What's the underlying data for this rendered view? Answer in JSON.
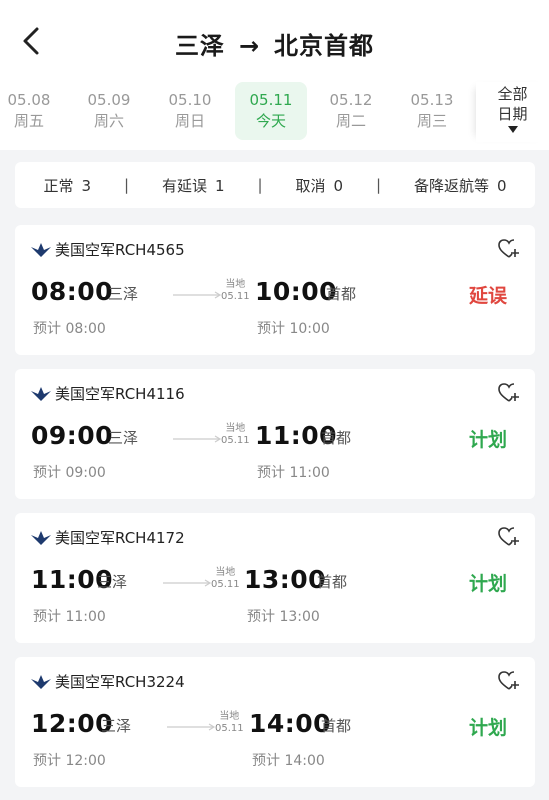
{
  "header": {
    "origin": "三泽",
    "arrow": "→",
    "destination": "北京首都"
  },
  "dates": [
    {
      "date": "05.08",
      "weekday": "周五"
    },
    {
      "date": "05.09",
      "weekday": "周六"
    },
    {
      "date": "05.10",
      "weekday": "周日"
    },
    {
      "date": "05.11",
      "weekday": "今天"
    },
    {
      "date": "05.12",
      "weekday": "周二"
    },
    {
      "date": "05.13",
      "weekday": "周三"
    }
  ],
  "all_dates": {
    "line1": "全部",
    "line2": "日期"
  },
  "summary": [
    {
      "label": "正常",
      "count": "3"
    },
    {
      "label": "有延误",
      "count": "1"
    },
    {
      "label": "取消",
      "count": "0"
    },
    {
      "label": "备降返航等",
      "count": "0"
    }
  ],
  "separator": "|",
  "flights": [
    {
      "airline": "美国空军",
      "number": "RCH4565",
      "dep_time": "08:00",
      "dep_city": "三泽",
      "local_label": "当地",
      "local_date": "05.11",
      "arr_time": "10:00",
      "arr_city": "首都",
      "dep_plan": "预计 08:00",
      "arr_plan": "预计 10:00",
      "status": "延误",
      "status_color": "#e0473f"
    },
    {
      "airline": "美国空军",
      "number": "RCH4116",
      "dep_time": "09:00",
      "dep_city": "三泽",
      "local_label": "当地",
      "local_date": "05.11",
      "arr_time": "11:00",
      "arr_city": "首都",
      "dep_plan": "预计 09:00",
      "arr_plan": "预计 11:00",
      "status": "计划",
      "status_color": "#2fa84f"
    },
    {
      "airline": "美国空军",
      "number": "RCH4172",
      "dep_time": "11:00",
      "dep_city": "三泽",
      "local_label": "当地",
      "local_date": "05.11",
      "arr_time": "13:00",
      "arr_city": "首都",
      "dep_plan": "预计 11:00",
      "arr_plan": "预计 13:00",
      "status": "计划",
      "status_color": "#2fa84f"
    },
    {
      "airline": "美国空军",
      "number": "RCH3224",
      "dep_time": "12:00",
      "dep_city": "三泽",
      "local_label": "当地",
      "local_date": "05.11",
      "arr_time": "14:00",
      "arr_city": "首都",
      "dep_plan": "预计 12:00",
      "arr_plan": "预计 14:00",
      "status": "计划",
      "status_color": "#2fa84f"
    }
  ],
  "colors": {
    "accent_green": "#2fa84f",
    "delay_red": "#e0473f",
    "active_bg": "#eaf7ee"
  },
  "icons": {
    "back": "chevron-left-icon",
    "favorite": "heart-plus-icon",
    "airline_logo": "usaf-wings-icon",
    "date_dropdown": "triangle-down-icon",
    "route": "arrow-right-icon"
  }
}
